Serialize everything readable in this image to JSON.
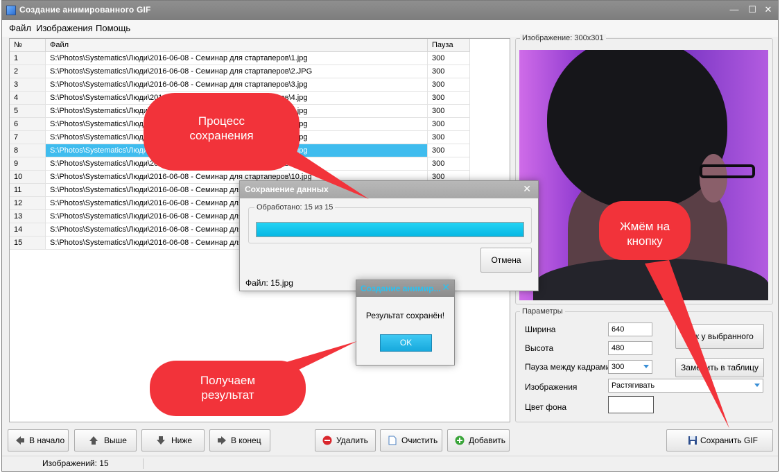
{
  "window": {
    "title": "Создание анимированного GIF",
    "minimize": "—",
    "maximize": "☐",
    "close": "✕"
  },
  "menu": [
    "Файл",
    "Изображения",
    "Помощь"
  ],
  "table": {
    "headers": [
      "№",
      "Файл",
      "Пауза"
    ],
    "selected_index": 7,
    "rows": [
      {
        "num": "1",
        "file": "S:\\Photos\\Systematics\\Люди\\2016-06-08 - Семинар для стартаперов\\1.jpg",
        "pause": "300"
      },
      {
        "num": "2",
        "file": "S:\\Photos\\Systematics\\Люди\\2016-06-08 - Семинар для стартаперов\\2.JPG",
        "pause": "300"
      },
      {
        "num": "3",
        "file": "S:\\Photos\\Systematics\\Люди\\2016-06-08 - Семинар для стартаперов\\3.jpg",
        "pause": "300"
      },
      {
        "num": "4",
        "file": "S:\\Photos\\Systematics\\Люди\\2016-06-08 - Семинар для стартаперов\\4.jpg",
        "pause": "300"
      },
      {
        "num": "5",
        "file": "S:\\Photos\\Systematics\\Люди\\2016-06-08 - Семинар для стартаперов\\5.jpg",
        "pause": "300"
      },
      {
        "num": "6",
        "file": "S:\\Photos\\Systematics\\Люди\\2016-06-08 - Семинар для стартаперов\\6.jpg",
        "pause": "300"
      },
      {
        "num": "7",
        "file": "S:\\Photos\\Systematics\\Люди\\2016-06-08 - Семинар для стартаперов\\7.jpg",
        "pause": "300"
      },
      {
        "num": "8",
        "file": "S:\\Photos\\Systematics\\Люди\\2016-06-08 - Семинар для стартаперов\\8.jpg",
        "pause": "300"
      },
      {
        "num": "9",
        "file": "S:\\Photos\\Systematics\\Люди\\2016-06-08 - Семинар для стартаперов\\9.jpg",
        "pause": "300"
      },
      {
        "num": "10",
        "file": "S:\\Photos\\Systematics\\Люди\\2016-06-08 - Семинар для стартаперов\\10.jpg",
        "pause": "300"
      },
      {
        "num": "11",
        "file": "S:\\Photos\\Systematics\\Люди\\2016-06-08 - Семинар для стартаперов\\11.jpg",
        "pause": "300"
      },
      {
        "num": "12",
        "file": "S:\\Photos\\Systematics\\Люди\\2016-06-08 - Семинар для стартаперов\\12.jpg",
        "pause": "300"
      },
      {
        "num": "13",
        "file": "S:\\Photos\\Systematics\\Люди\\2016-06-08 - Семинар для стартаперов\\13.jpg",
        "pause": "300"
      },
      {
        "num": "14",
        "file": "S:\\Photos\\Systematics\\Люди\\2016-06-08 - Семинар для стартаперов\\14.jpg",
        "pause": "300"
      },
      {
        "num": "15",
        "file": "S:\\Photos\\Systematics\\Люди\\2016-06-08 - Семинар для стартаперов\\15.jpg",
        "pause": "300"
      }
    ]
  },
  "preview": {
    "caption": "Изображение: 300x301"
  },
  "params": {
    "caption": "Параметры",
    "width_label": "Ширина",
    "width_value": "640",
    "height_label": "Высота",
    "height_value": "480",
    "pause_label": "Пауза между кадрами",
    "pause_value": "300",
    "images_label": "Изображения",
    "images_value": "Растягивать",
    "bg_label": "Цвет фона",
    "bg_color": "#ffffff",
    "as_selected_button": "Как у выбранного",
    "apply_table_button": "Заменить в таблицу"
  },
  "buttons": {
    "to_start": "В начало",
    "up": "Выше",
    "down": "Ниже",
    "to_end": "В конец",
    "delete": "Удалить",
    "clear": "Очистить",
    "add": "Добавить",
    "save_gif": "Сохранить GIF"
  },
  "status": {
    "images_count": "Изображений: 15"
  },
  "save_dialog": {
    "title": "Сохранение данных",
    "close": "✕",
    "progress_caption": "Обработано: 15 из 15",
    "progress_fraction": 1.0,
    "cancel": "Отмена",
    "file": "Файл: 15.jpg"
  },
  "result_dialog": {
    "title": "Создание анимир...",
    "close": "✕",
    "message": "Результат сохранён!",
    "ok": "OK"
  },
  "annotations": {
    "process": "Процесс сохранения",
    "click": "Жмём на кнопку",
    "result": "Получаем результат"
  },
  "colors": {
    "accent": "#3fbcee",
    "progress": "#06b7e3",
    "callout": "#f2333a"
  }
}
